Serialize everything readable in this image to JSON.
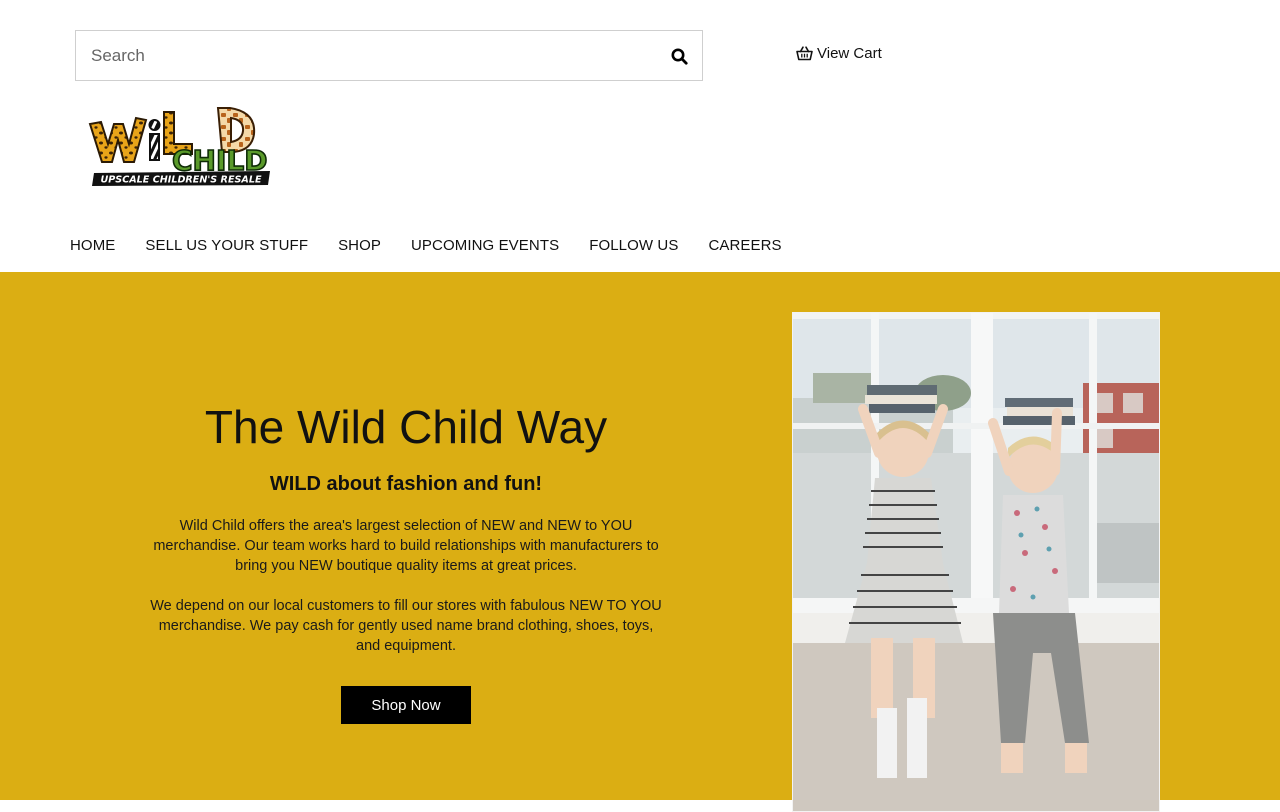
{
  "search": {
    "placeholder": "Search"
  },
  "cart": {
    "label": "View Cart"
  },
  "logo": {
    "alt": "Wild Child Upscale Children's Resale",
    "wordmark_top": "WiLD",
    "wordmark_bottom": "CHILD",
    "tagline": "UPSCALE CHILDREN'S RESALE"
  },
  "nav": {
    "items": [
      {
        "label": "HOME"
      },
      {
        "label": "SELL US YOUR STUFF"
      },
      {
        "label": "SHOP"
      },
      {
        "label": "UPCOMING EVENTS"
      },
      {
        "label": "FOLLOW US"
      },
      {
        "label": "CAREERS"
      }
    ]
  },
  "hero": {
    "title": "The Wild Child Way",
    "subtitle": "WILD about fashion and fun!",
    "paragraph1": "Wild Child offers the area's largest selection of NEW and NEW to YOU merchandise. Our team works hard to build relationships with manufacturers to bring you NEW boutique quality items at great prices.",
    "paragraph2": "We depend on our local customers to fill our stores with fabulous NEW TO YOU merchandise. We pay cash for gently used name brand clothing, shoes, toys, and equipment.",
    "button": "Shop Now",
    "bg_color": "#dbae13"
  },
  "icons": {
    "search": "search-icon",
    "cart": "basket-icon"
  }
}
